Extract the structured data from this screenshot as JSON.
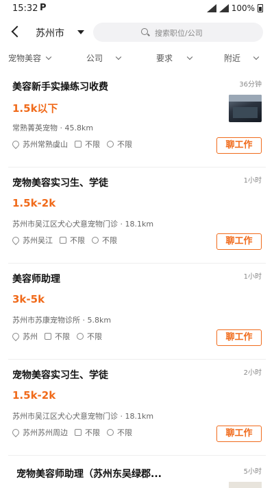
{
  "status_bar": {
    "time": "15:32",
    "app_badge": "P",
    "battery": "100%"
  },
  "header": {
    "city": "苏州市",
    "search_placeholder": "搜索职位/公司"
  },
  "filters": [
    {
      "label": "宠物美容"
    },
    {
      "label": "公司"
    },
    {
      "label": "要求"
    },
    {
      "label": "附近"
    }
  ],
  "jobs": [
    {
      "title": "美容新手实操练习收费",
      "time": "36分钟",
      "salary": "1.5k以下",
      "company": "常熟菁英宠物 · 45.8km",
      "location": "苏州常熟虞山",
      "experience": "不限",
      "education": "不限",
      "chat": "聊工作",
      "has_thumb": true
    },
    {
      "title": "宠物美容实习生、学徒",
      "time": "1小时",
      "salary": "1.5k-2k",
      "company": "苏州市吴江区犬心犬意宠物门诊 · 18.1km",
      "location": "苏州吴江",
      "experience": "不限",
      "education": "不限",
      "chat": "聊工作"
    },
    {
      "title": "美容师助理",
      "time": "1小时",
      "salary": "3k-5k",
      "company": "苏州市苏康宠物诊所 · 5.8km",
      "location": "苏州",
      "experience": "不限",
      "education": "不限",
      "chat": "聊工作"
    },
    {
      "title": "宠物美容实习生、学徒",
      "time": "2小时",
      "salary": "1.5k-2k",
      "company": "苏州市吴江区犬心犬意宠物门诊 · 18.1km",
      "location": "苏州苏州周边",
      "experience": "不限",
      "education": "不限",
      "chat": "聊工作"
    },
    {
      "title": "宠物美容师助理（苏州东吴绿郡...",
      "time": "5小时"
    }
  ],
  "colors": {
    "accent": "#f06a1a"
  }
}
